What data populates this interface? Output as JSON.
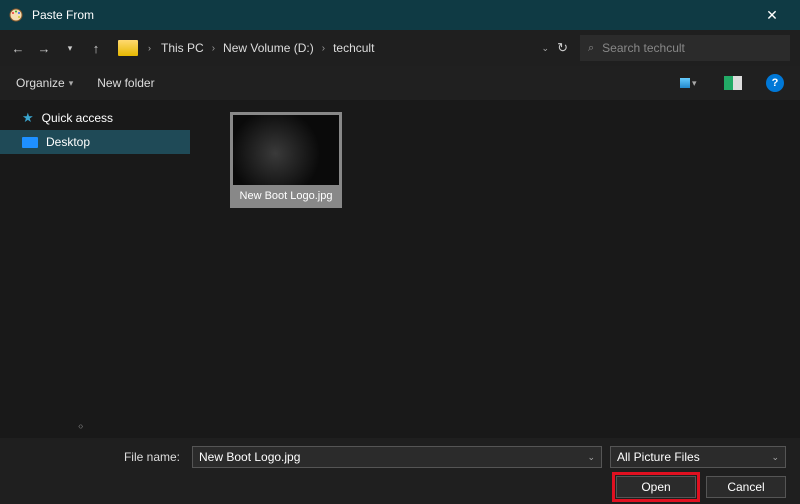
{
  "titlebar": {
    "title": "Paste From"
  },
  "breadcrumb": {
    "root": "This PC",
    "drive": "New Volume (D:)",
    "folder": "techcult"
  },
  "search": {
    "placeholder": "Search techcult"
  },
  "toolbar": {
    "organize": "Organize",
    "newfolder": "New folder"
  },
  "sidebar": {
    "quick": "Quick access",
    "desktop": "Desktop"
  },
  "file": {
    "thumb_label": "New Boot Logo.jpg"
  },
  "footer": {
    "filename_label": "File name:",
    "filename_value": "New Boot Logo.jpg",
    "filter": "All Picture Files",
    "open": "Open",
    "cancel": "Cancel"
  }
}
